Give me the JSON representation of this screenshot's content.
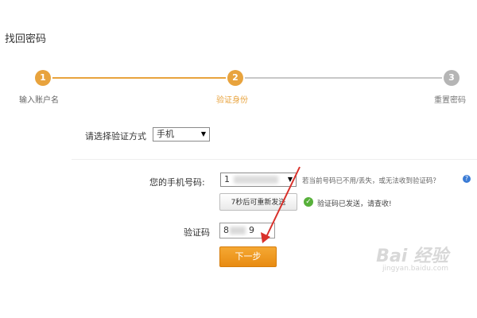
{
  "page": {
    "title": "找回密码"
  },
  "steps": [
    {
      "num": "1",
      "label": "输入账户名",
      "state": "done"
    },
    {
      "num": "2",
      "label": "验证身份",
      "state": "active"
    },
    {
      "num": "3",
      "label": "重置密码",
      "state": "pending"
    }
  ],
  "method": {
    "label": "请选择验证方式",
    "selected": "手机"
  },
  "phone": {
    "label": "您的手机号码:",
    "value": "1",
    "help": "若当前号码已不用/丢失，或无法收到验证码？",
    "help_icon": "help-icon"
  },
  "resend": {
    "button_label": "7秒后可重新发送",
    "status": "验证码已发送，请查收!"
  },
  "code": {
    "label": "验证码",
    "value": "8",
    "value_tail": "9"
  },
  "next": {
    "label": "下一步"
  },
  "watermark": {
    "text": "Bai 经验",
    "url": "jingyan.baidu.com"
  },
  "colors": {
    "accent": "#e8a33d",
    "inactive": "#b5b5b5",
    "success": "#57b03a",
    "annotation": "#d9312b"
  }
}
